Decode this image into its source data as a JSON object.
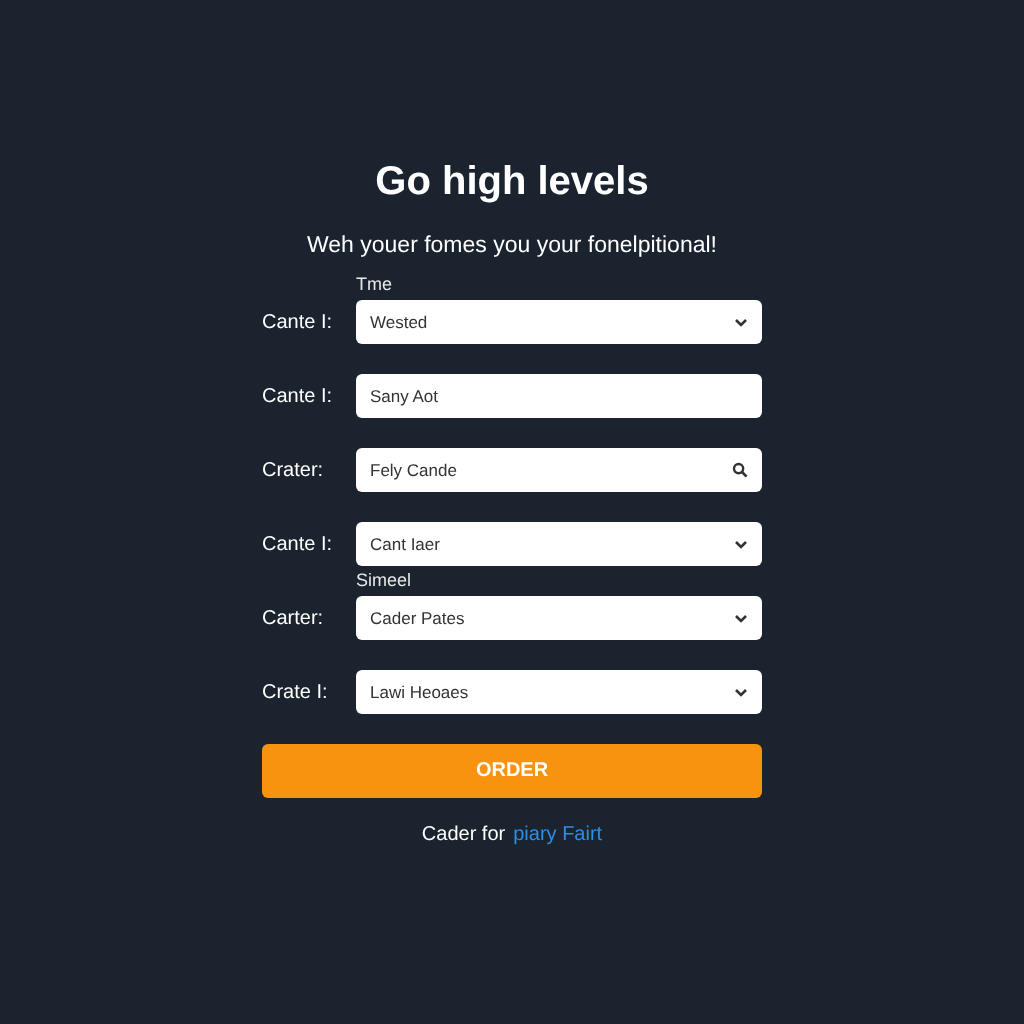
{
  "title": "Go high levels",
  "subtitle": "Weh youer fomes you your fonelpitional!",
  "fields": [
    {
      "label": "Cante I:",
      "caption": "Tme",
      "kind": "select",
      "value": "Wested"
    },
    {
      "label": "Cante I:",
      "kind": "text",
      "value": "Sany Aot"
    },
    {
      "label": "Crater:",
      "kind": "search",
      "value": "Fely Cande"
    },
    {
      "label": "Cante I:",
      "kind": "select",
      "value": "Cant Iaer"
    },
    {
      "label": "Carter:",
      "caption": "Simeel",
      "kind": "select",
      "value": "Cader Pates"
    },
    {
      "label": "Crate I:",
      "kind": "select",
      "value": "Lawi Heoaes"
    }
  ],
  "button": "ORDER",
  "footer": {
    "text": "Cader for",
    "link": "piary Fairt"
  }
}
